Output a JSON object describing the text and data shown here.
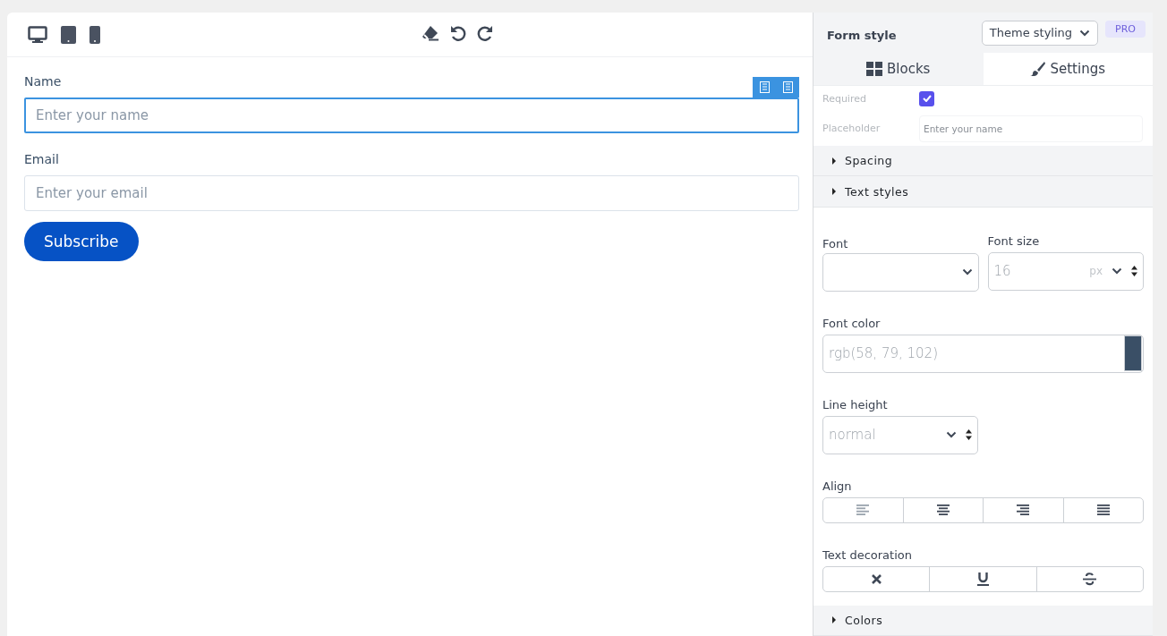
{
  "form": {
    "fields": [
      {
        "label": "Name",
        "placeholder": "Enter your name",
        "selected": true
      },
      {
        "label": "Email",
        "placeholder": "Enter your email",
        "selected": false
      }
    ],
    "submit_button": "Subscribe"
  },
  "panel": {
    "title": "Form style",
    "style_select": "Theme styling",
    "badge": "PRO",
    "tabs": [
      {
        "label": "Blocks",
        "selected": false
      },
      {
        "label": "Settings",
        "selected": true
      }
    ],
    "required": {
      "label": "Required",
      "checked": true
    },
    "placeholder_setting": {
      "label": "Placeholder",
      "placeholder": "Enter your name"
    },
    "sections": [
      {
        "label": "Spacing",
        "expanded": false
      },
      {
        "label": "Text styles",
        "expanded": true
      },
      {
        "label": "Colors",
        "expanded": false
      }
    ],
    "text_styles": {
      "font": {
        "label": "Font"
      },
      "font_size": {
        "label": "Font size",
        "value": "16",
        "unit": "px"
      },
      "font_color": {
        "label": "Font color",
        "value": "rgb(58, 79, 102)"
      },
      "line_height": {
        "label": "Line height",
        "value": "normal"
      },
      "align": {
        "label": "Align",
        "options": [
          {
            "kind": "left"
          },
          {
            "kind": "center"
          },
          {
            "kind": "right"
          },
          {
            "kind": "justify"
          }
        ]
      },
      "decoration": {
        "label": "Text decoration",
        "options": [
          {
            "kind": "none"
          },
          {
            "kind": "underline"
          },
          {
            "kind": "strike"
          }
        ]
      }
    }
  }
}
